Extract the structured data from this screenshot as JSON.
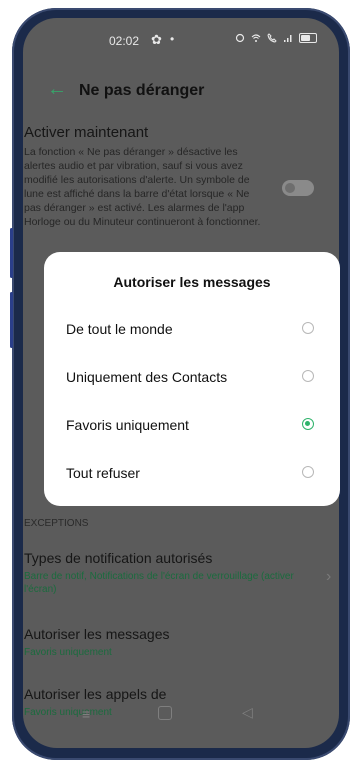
{
  "status_bar": {
    "time": "02:02",
    "gear_icon": "gear-icon",
    "dot": "•"
  },
  "header": {
    "title": "Ne pas déranger",
    "back_icon": "back-arrow-icon"
  },
  "activer": {
    "title": "Activer maintenant",
    "description": "La fonction « Ne pas déranger » désactive les alertes audio et par vibration, sauf si vous avez modifié les autorisations d'alerte. Un symbole de lune est affiché dans la barre d'état lorsque « Ne pas déranger » est activé. Les alarmes de l'app Horloge ou du Minuteur continueront à fonctionner.",
    "toggle_on": false
  },
  "dialog": {
    "title": "Autoriser les messages",
    "options": [
      {
        "label": "De tout le monde",
        "selected": false
      },
      {
        "label": "Uniquement des Contacts",
        "selected": false
      },
      {
        "label": "Favoris uniquement",
        "selected": true
      },
      {
        "label": "Tout refuser",
        "selected": false
      }
    ]
  },
  "exceptions": {
    "label": "EXCEPTIONS",
    "items": [
      {
        "title": "Types de notification autorisés",
        "subtitle": "Barre de notif, Notifications de l'écran de verrouillage (activer l'écran)"
      },
      {
        "title": "Autoriser les messages",
        "subtitle": "Favoris uniquement"
      },
      {
        "title": "Autoriser les appels de",
        "subtitle": "Favoris uniquement"
      }
    ]
  },
  "nav_bar": {
    "menu": "≡",
    "back": "◁"
  },
  "colors": {
    "accent": "#2fb36b",
    "dim_background": "#5b5b5b",
    "phone_frame": "#1b2a4a"
  }
}
